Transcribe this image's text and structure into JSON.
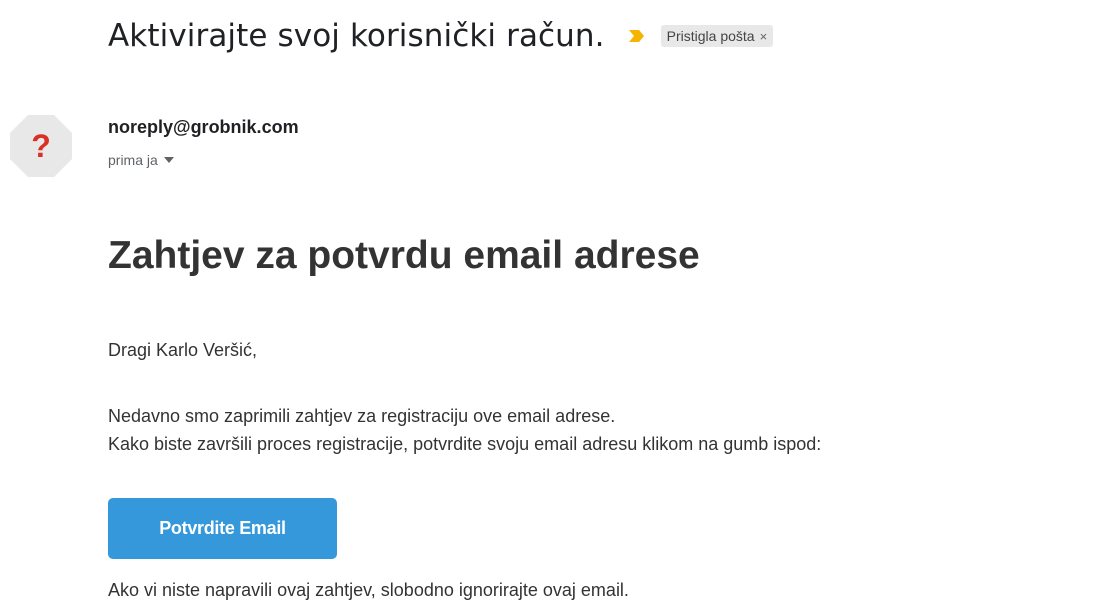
{
  "email": {
    "subject": "Aktivirajte svoj korisnički račun.",
    "label": "Pristigla pošta",
    "label_close": "×",
    "importance_icon": "importance-marker-icon",
    "sender": {
      "email": "noreply@grobnik.com",
      "recipient_text": "prima ja",
      "avatar_icon": "unknown-sender-question-icon",
      "avatar_color": "#e8e8e8",
      "avatar_glyph": "?",
      "avatar_glyph_color": "#d93025"
    },
    "body": {
      "heading": "Zahtjev za potvrdu email adrese",
      "greeting": "Dragi Karlo Veršić,",
      "paragraph_line1": "Nedavno smo zaprimili zahtjev za registraciju ove email adrese.",
      "paragraph_line2": "Kako biste završili proces registracije, potvrdite svoju email adresu klikom na gumb ispod:",
      "button_label": "Potvrdite Email",
      "footer_note": "Ako vi niste napravili ovaj zahtjev, slobodno ignorirajte ovaj email."
    }
  },
  "colors": {
    "button": "#3498db",
    "importance": "#f4b400",
    "text": "#333333"
  }
}
